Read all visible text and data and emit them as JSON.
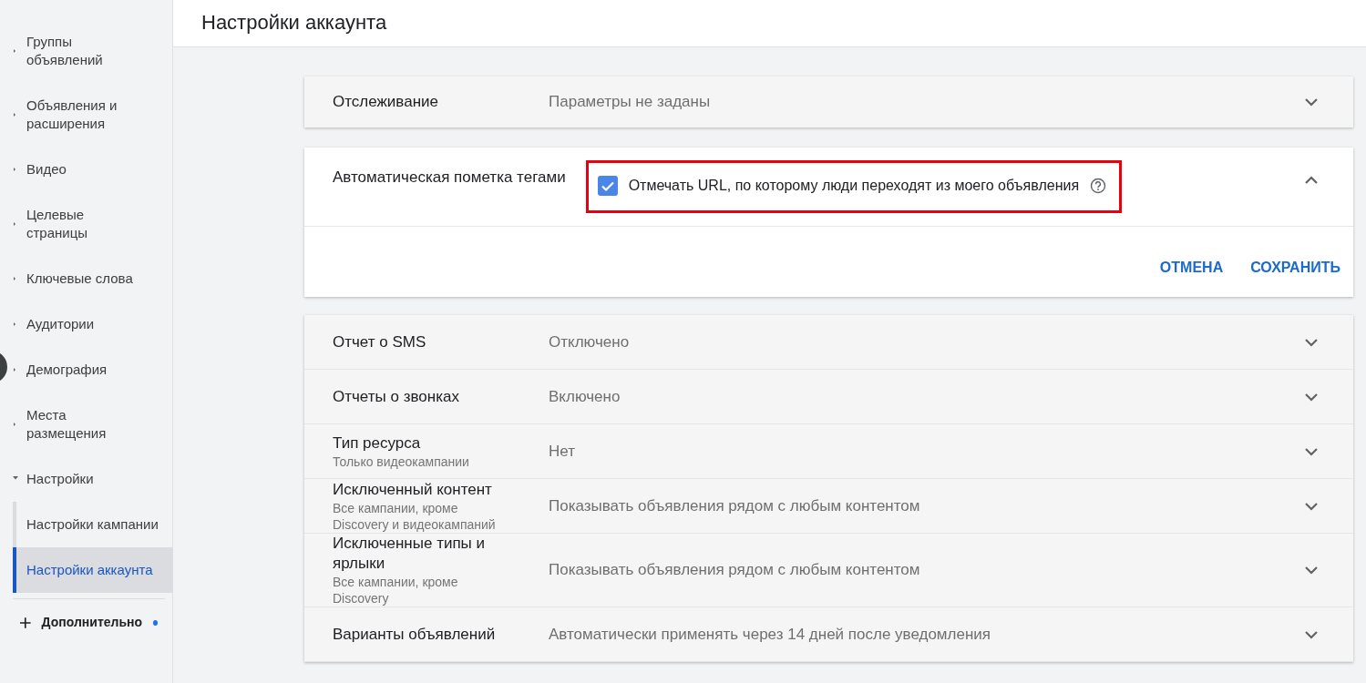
{
  "sidebar": {
    "items": [
      {
        "label": "Группы объявлений",
        "expanded": false
      },
      {
        "label": "Объявления и расширения",
        "expanded": false
      },
      {
        "label": "Видео",
        "expanded": false
      },
      {
        "label": "Целевые страницы",
        "expanded": false
      },
      {
        "label": "Ключевые слова",
        "expanded": false
      },
      {
        "label": "Аудитории",
        "expanded": false
      },
      {
        "label": "Демография",
        "expanded": false
      },
      {
        "label": "Места размещения",
        "expanded": false
      },
      {
        "label": "Настройки",
        "expanded": true,
        "children": [
          {
            "label": "Настройки кампании",
            "selected": false
          },
          {
            "label": "Настройки аккаунта",
            "selected": true
          }
        ]
      }
    ],
    "footer": {
      "label": "Дополнительно",
      "notification_dot": true
    }
  },
  "page_title": "Настройки аккаунта",
  "sections": [
    {
      "kind": "collapsed",
      "title": "Отслеживание",
      "value": "Параметры не заданы"
    },
    {
      "kind": "expanded",
      "title": "Автоматическая пометка тегами",
      "option": {
        "label": "Отмечать URL, по которому люди переходят из моего объявления",
        "checked": true,
        "highlighted": true
      },
      "buttons": [
        "ОТМЕНА",
        "СОХРАНИТЬ"
      ]
    },
    {
      "kind": "group",
      "rows": [
        {
          "title": "Отчет о SMS",
          "value": "Отключено"
        },
        {
          "title": "Отчеты о звонках",
          "value": "Включено"
        },
        {
          "title": "Тип ресурса",
          "subtitle": "Только видеокампании",
          "value": "Нет"
        },
        {
          "title": "Исключенный контент",
          "subtitle": "Все кампании, кроме Discovery и видеокампаний",
          "value": "Показывать объявления рядом с любым контентом"
        },
        {
          "title": "Исключенные типы и ярлыки",
          "subtitle": "Все кампании, кроме Discovery",
          "value": "Показывать объявления рядом с любым контентом"
        },
        {
          "title": "Варианты объявлений",
          "value": "Автоматически применять через 14 дней после уведомления"
        }
      ]
    }
  ]
}
